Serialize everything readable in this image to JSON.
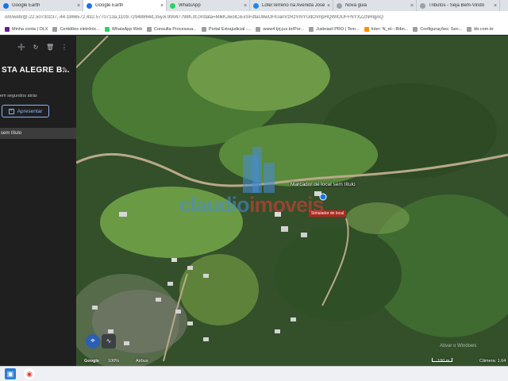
{
  "tabs": [
    {
      "label": "Google Earth",
      "color": "#1a73e8",
      "active": false
    },
    {
      "label": "Google Earth",
      "color": "#1a73e8",
      "active": true
    },
    {
      "label": "WhatsApp",
      "color": "#25d366",
      "active": false
    },
    {
      "label": "Lote/Terreno na Avenida José ...",
      "color": "#1e88e5",
      "active": false
    },
    {
      "label": "Nova guia",
      "color": "#9aa0a6",
      "active": false
    },
    {
      "label": "Tributos - Seja Bem-Vindo",
      "color": "#9aa0a6",
      "active": false
    }
  ],
  "address_bar": {
    "url": "om/web/@-22.50730237,-44.1866572,432.5770713a,1109.72948864d,35y,6.99047798h,0t,0r/data=MikKJwolCiExSFdtaU8wOFlUanVzRzVmYUdOVnpHQWIOUFFNYXZZNHlgAQ"
  },
  "bookmarks": [
    {
      "label": "Minha conta | OLX",
      "color": "#6a1b9a"
    },
    {
      "label": "Certidões eletrônic...",
      "color": "#9e9e9e"
    },
    {
      "label": "WhatsApp Web",
      "color": "#25d366"
    },
    {
      "label": "Consulta Processua...",
      "color": "#9e9e9e"
    },
    {
      "label": "Portal Extrajudicial -...",
      "color": "#9e9e9e"
    },
    {
      "label": "www4.tjrj.jus.br/Por...",
      "color": "#9e9e9e"
    },
    {
      "label": "Jusbrasil PRO | Tem...",
      "color": "#9e9e9e"
    },
    {
      "label": "Inter: N_et---Bibn...",
      "color": "#ff8f00"
    },
    {
      "label": "Configurações: Sen...",
      "color": "#9e9e9e"
    },
    {
      "label": "bb.com.br",
      "color": "#9e9e9e"
    }
  ],
  "sidebar": {
    "title": "STA ALEGRE B...",
    "saved_text": "em segundos atrás",
    "present_label": "Apresentar",
    "item_label": "sem título",
    "icons": [
      "add-person-icon",
      "refresh-icon",
      "trash-icon",
      "more-icon"
    ]
  },
  "map": {
    "placemark_label": "Marcador de local sem título",
    "pin_tag": "Simulador de local",
    "watermark_left": "claudio",
    "watermark_right": "imoveis",
    "footer": {
      "google": "Google",
      "coverage": "100%",
      "airbus": "Airbus",
      "scale": "100 m",
      "camera": "Câmera: 1.64",
      "activate": "Ativar o Windows"
    }
  },
  "colors": {
    "accent": "#8ab4f8",
    "sidebar_bg": "#1f1f1f",
    "pin_tag_bg": "#b3261e"
  }
}
